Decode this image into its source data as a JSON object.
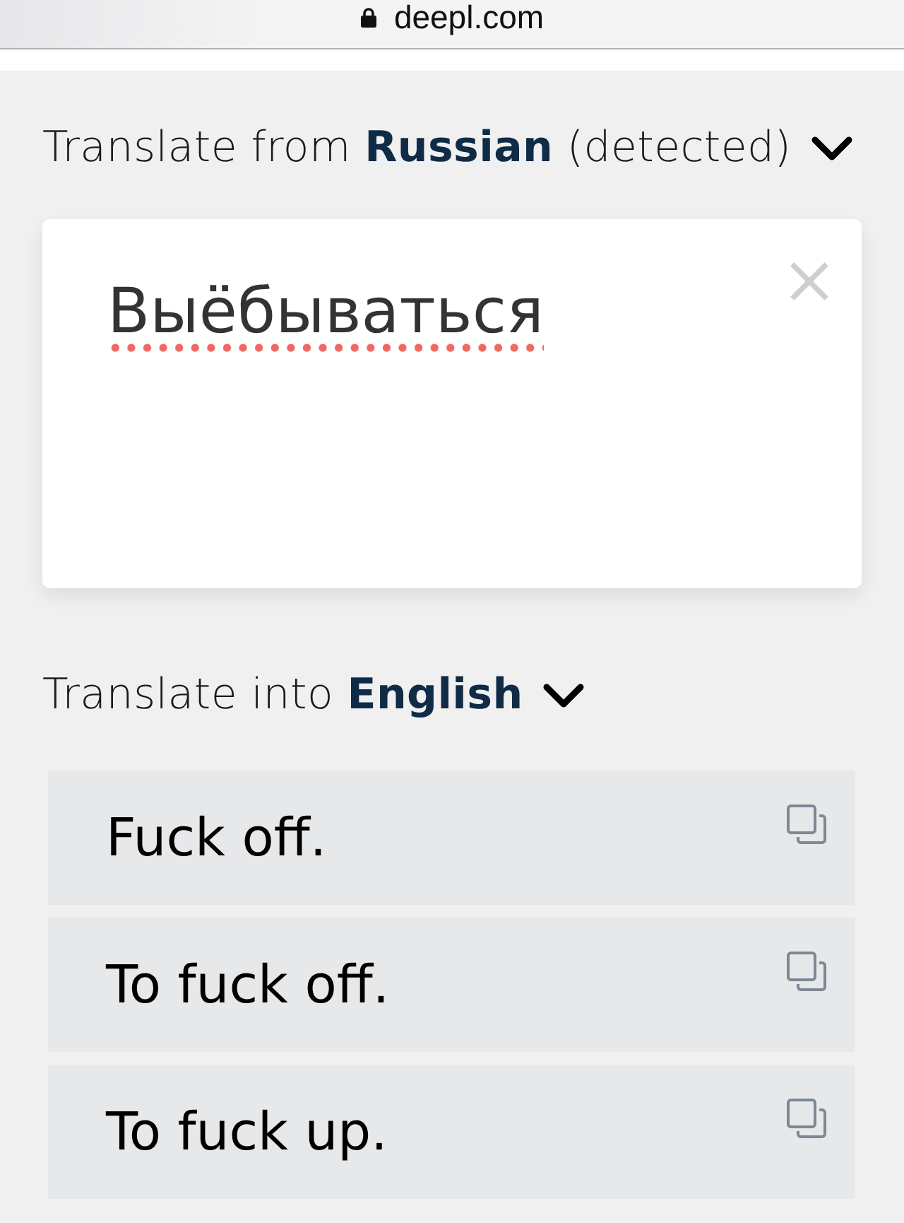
{
  "browser": {
    "url": "deepl.com",
    "secure": true
  },
  "source": {
    "heading": "Translate from **Russian** (detected)",
    "text": "Выёбываться",
    "misspelled": true
  },
  "target": {
    "heading": "Translate into **English**"
  },
  "translations": [
    {
      "text": "Fuck off."
    },
    {
      "text": "To fuck off."
    },
    {
      "text": "To fuck up."
    }
  ]
}
